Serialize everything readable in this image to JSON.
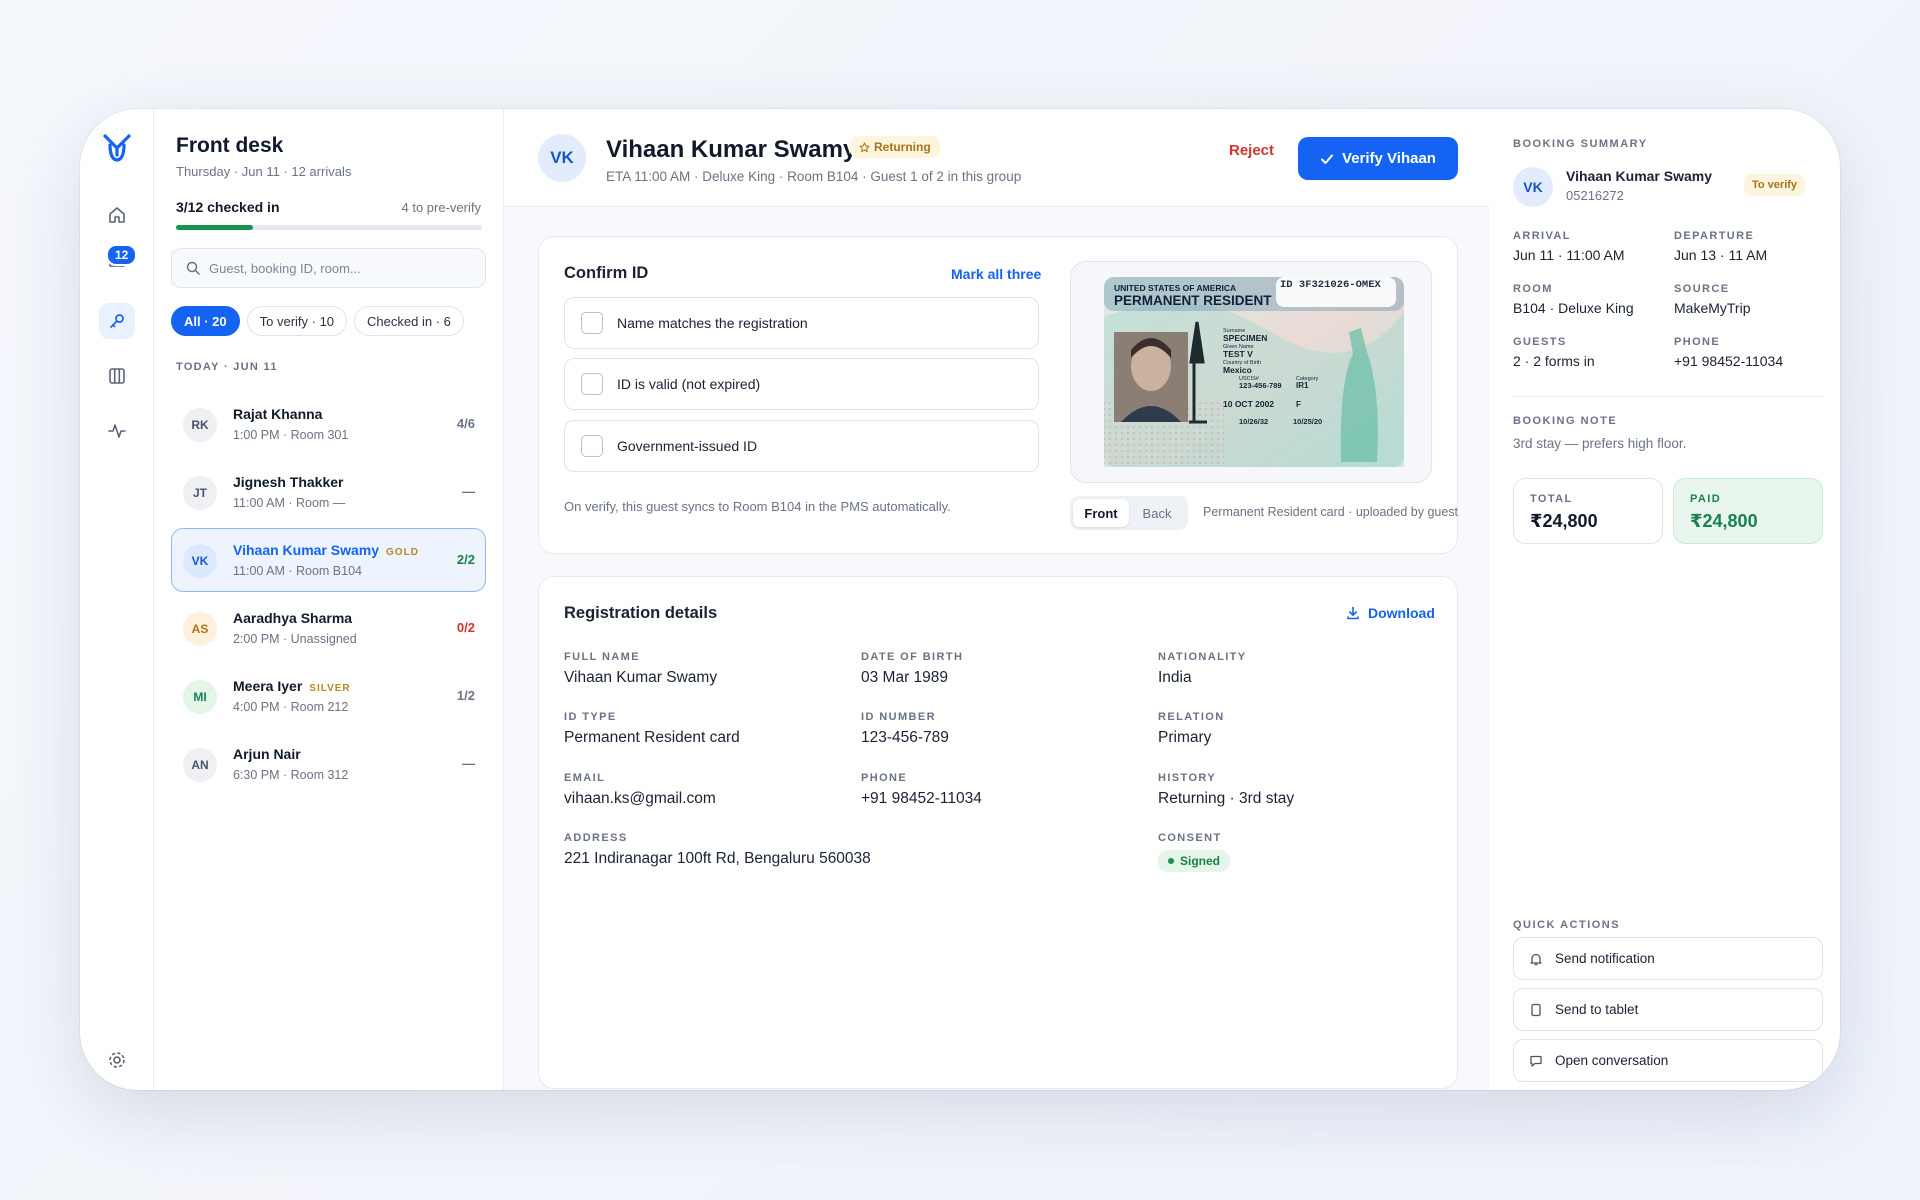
{
  "nav": {
    "inbox_badge": "12"
  },
  "frontdesk": {
    "title": "Front desk",
    "subtitle": "Thursday · Jun 11 · 12 arrivals",
    "checked_in": "3/12 checked in",
    "pre_verify": "4 to pre-verify",
    "progress": 0.25,
    "search_placeholder": "Guest, booking ID, room...",
    "filters": [
      "All · 20",
      "To verify · 10",
      "Checked in · 6"
    ],
    "day_label": "TODAY · JUN 11",
    "guests": [
      {
        "initials": "RK",
        "name": "Rajat Khanna",
        "tier": "",
        "meta": "1:00 PM · Room 301",
        "count": "4/6"
      },
      {
        "initials": "JT",
        "name": "Jignesh Thakker",
        "tier": "",
        "meta": "11:00 AM · Room —",
        "count": "—"
      },
      {
        "initials": "VK",
        "name": "Vihaan Kumar Swamy",
        "tier": "GOLD",
        "meta": "11:00 AM · Room B104",
        "count": "2/2"
      },
      {
        "initials": "AS",
        "name": "Aaradhya Sharma",
        "tier": "",
        "meta": "2:00 PM · Unassigned",
        "count": "0/2"
      },
      {
        "initials": "MI",
        "name": "Meera Iyer",
        "tier": "SILVER",
        "meta": "4:00 PM · Room 212",
        "count": "1/2"
      },
      {
        "initials": "AN",
        "name": "Arjun Nair",
        "tier": "",
        "meta": "6:30 PM · Room 312",
        "count": "—"
      }
    ]
  },
  "guest": {
    "initials": "VK",
    "name": "Vihaan Kumar Swamy",
    "badge": "Returning",
    "subline": "ETA 11:00 AM · Deluxe King · Room B104 · Guest 1 of 2 in this group",
    "reject": "Reject",
    "verify": "Verify Vihaan"
  },
  "confirm": {
    "title": "Confirm ID",
    "mark_all": "Mark all three",
    "checks": [
      "Name matches the registration",
      "ID is valid (not expired)",
      "Government-issued ID"
    ],
    "note": "On verify, this guest syncs to Room B104 in the PMS automatically.",
    "card": {
      "header": "UNITED STATES OF AMERICA",
      "title": "PERMANENT RESIDENT",
      "id": "ID 3F321026-OMEX",
      "surname_label": "Surname",
      "surname": "SPECIMEN",
      "given_label": "Given Name",
      "given": "TEST V",
      "country_label": "Country of Birth",
      "country": "Mexico",
      "uscis_label": "USCIS#",
      "uscis": "123-456-789",
      "category_label": "Category",
      "category": "IR1",
      "dob": "10 OCT 2002",
      "sex": "F",
      "card_expires": "10/26/32",
      "resident_since": "10/25/20"
    },
    "tabs": [
      "Front",
      "Back"
    ],
    "caption": "Permanent Resident card · uploaded by guest"
  },
  "registration": {
    "title": "Registration details",
    "download": "Download",
    "fields": [
      {
        "label": "FULL NAME",
        "value": "Vihaan Kumar Swamy"
      },
      {
        "label": "DATE OF BIRTH",
        "value": "03 Mar 1989"
      },
      {
        "label": "NATIONALITY",
        "value": "India"
      },
      {
        "label": "ID TYPE",
        "value": "Permanent Resident card"
      },
      {
        "label": "ID NUMBER",
        "value": "123-456-789"
      },
      {
        "label": "RELATION",
        "value": "Primary"
      },
      {
        "label": "EMAIL",
        "value": "vihaan.ks@gmail.com"
      },
      {
        "label": "PHONE",
        "value": "+91 98452-11034"
      },
      {
        "label": "HISTORY",
        "value": "Returning · 3rd stay"
      },
      {
        "label": "ADDRESS",
        "value": "221 Indiranagar 100ft Rd, Bengaluru 560038"
      },
      {
        "label": "CONSENT",
        "value": "Signed"
      }
    ]
  },
  "summary": {
    "label": "BOOKING SUMMARY",
    "initials": "VK",
    "name": "Vihaan Kumar Swamy",
    "booking_id": "05216272",
    "status": "To verify",
    "info": [
      {
        "label": "ARRIVAL",
        "value": "Jun 11 · 11:00 AM"
      },
      {
        "label": "DEPARTURE",
        "value": "Jun 13 · 11 AM"
      },
      {
        "label": "ROOM",
        "value": "B104 · Deluxe King"
      },
      {
        "label": "SOURCE",
        "value": "MakeMyTrip"
      },
      {
        "label": "GUESTS",
        "value": "2 · 2 forms in"
      },
      {
        "label": "PHONE",
        "value": "+91 98452-11034"
      }
    ],
    "note_label": "BOOKING NOTE",
    "note": "3rd stay — prefers high floor.",
    "total_label": "TOTAL",
    "total": "₹24,800",
    "paid_label": "PAID",
    "paid": "₹24,800",
    "actions_label": "QUICK ACTIONS",
    "actions": [
      "Send notification",
      "Send to tablet",
      "Open conversation"
    ]
  },
  "colors": {
    "accent": "#1463f3",
    "success": "#17924f",
    "danger": "#d3342b",
    "gold": "#b58a1e"
  }
}
